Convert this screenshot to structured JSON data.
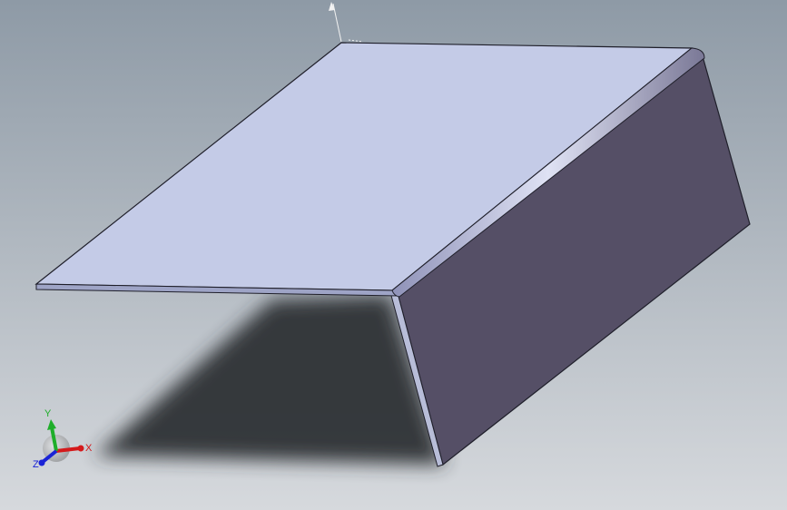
{
  "viewport": {
    "background_top": "#8e9aa6",
    "background_bottom": "#d6d9dd"
  },
  "model": {
    "top_face_color": "#c4cbe7",
    "side_face_color": "#554f66",
    "edge_color": "#1f1f2a",
    "shadow_color": "#2e3035"
  },
  "triad": {
    "x_label": "X",
    "y_label": "Y",
    "z_label": "Z",
    "x_color": "#d4191b",
    "y_color": "#1fae2a",
    "z_color": "#1a23d6"
  }
}
